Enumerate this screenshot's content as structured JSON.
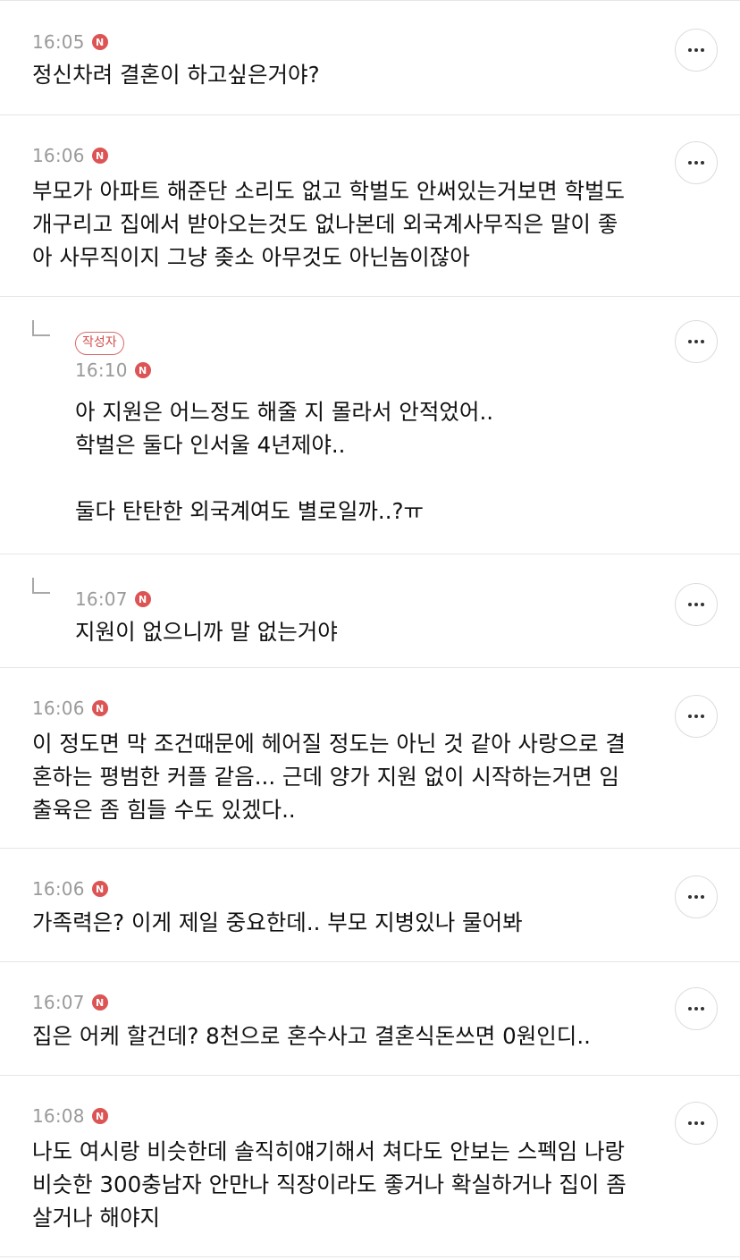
{
  "author_badge": "작성자",
  "new_badge": "N",
  "comments": [
    {
      "time": "16:05",
      "text": "정신차려 결혼이 하고싶은거야?"
    },
    {
      "time": "16:06",
      "text": "부모가 아파트 해준단 소리도 없고 학벌도 안써있는거보면 학벌도\n개구리고 집에서 받아오는것도 없나본데 외국계사무직은 말이 좋\n아 사무직이지 그냥 좆소 아무것도 아닌놈이잖아"
    },
    {
      "time": "16:10",
      "text": "아 지원은 어느정도 해줄 지 몰라서 안적었어..\n학벌은 둘다 인서울 4년제야..\n\n둘다 탄탄한 외국계여도 별로일까..?ㅠ"
    },
    {
      "time": "16:07",
      "text": "지원이 없으니까 말 없는거야"
    },
    {
      "time": "16:06",
      "text": "이 정도면 막 조건때문에 헤어질 정도는 아닌 것 같아 사랑으로 결\n혼하는 평범한 커플 같음... 근데 양가 지원 없이 시작하는거면 임\n출육은 좀 힘들 수도 있겠다.."
    },
    {
      "time": "16:06",
      "text": "가족력은? 이게 제일 중요한데.. 부모 지병있나 물어봐"
    },
    {
      "time": "16:07",
      "text": "집은 어케 할건데? 8천으로 혼수사고 결혼식돈쓰면 0원인디.."
    },
    {
      "time": "16:08",
      "text": "나도 여시랑 비슷한데 솔직히얘기해서 쳐다도 안보는 스펙임 나랑\n비슷한 300충남자 안만나 직장이라도 좋거나 확실하거나 집이 좀\n살거나 해야지"
    }
  ]
}
